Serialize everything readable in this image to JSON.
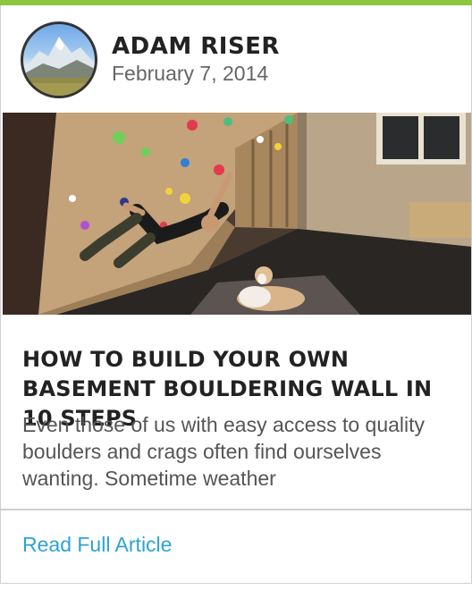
{
  "colors": {
    "accent_bar": "#8cc63f",
    "link": "#2ea3d4",
    "headline": "#222222"
  },
  "author": {
    "name": "ADAM RISER",
    "date": "February 7, 2014",
    "avatar_icon": "mountain-landscape"
  },
  "article": {
    "title": "HOW TO BUILD YOUR OWN BASEMENT BOULDERING WALL IN 10 STEPS",
    "excerpt": "Even those of us with easy access to quality boulders and crags often find ourselves wanting. Sometime weather",
    "read_more_label": "Read Full Article"
  }
}
